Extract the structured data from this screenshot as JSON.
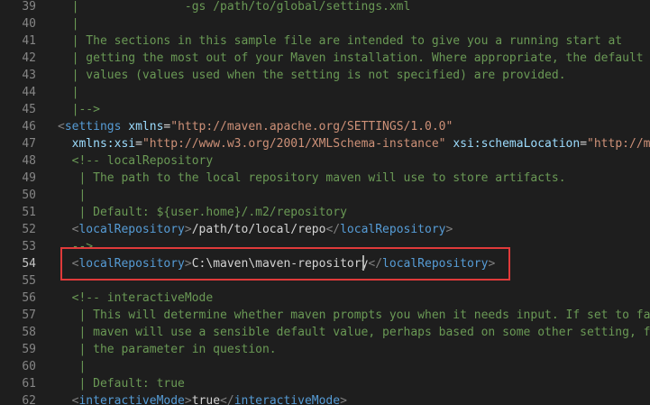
{
  "editor": {
    "colors": {
      "background": "#1e1e1e",
      "comment": "#6a9955",
      "tag": "#569cd6",
      "attribute": "#9cdcfe",
      "string": "#ce9178",
      "text": "#d4d4d4",
      "highlight_box": "#e03a3a"
    },
    "active_line": "54",
    "lines": [
      {
        "num": "39",
        "tokens": [
          {
            "t": "  | ",
            "c": "comment"
          },
          {
            "t": "              -gs /path/to/global/settings.xml",
            "c": "comment"
          }
        ]
      },
      {
        "num": "40",
        "tokens": [
          {
            "t": "  |",
            "c": "comment"
          }
        ]
      },
      {
        "num": "41",
        "tokens": [
          {
            "t": "  | The sections in this sample file are intended to give you a running start at",
            "c": "comment"
          }
        ]
      },
      {
        "num": "42",
        "tokens": [
          {
            "t": "  | getting the most out of your Maven installation. Where appropriate, the default",
            "c": "comment"
          }
        ]
      },
      {
        "num": "43",
        "tokens": [
          {
            "t": "  | values (values used when the setting is not specified) are provided.",
            "c": "comment"
          }
        ]
      },
      {
        "num": "44",
        "tokens": [
          {
            "t": "  |",
            "c": "comment"
          }
        ]
      },
      {
        "num": "45",
        "tokens": [
          {
            "t": "  |-->",
            "c": "comment"
          }
        ]
      },
      {
        "num": "46",
        "tokens": [
          {
            "t": "<",
            "c": "bracket"
          },
          {
            "t": "settings",
            "c": "tag"
          },
          {
            "t": " ",
            "c": "text"
          },
          {
            "t": "xmlns",
            "c": "attr"
          },
          {
            "t": "=",
            "c": "eq"
          },
          {
            "t": "\"http://maven.apache.org/SETTINGS/1.0.0\"",
            "c": "str"
          }
        ]
      },
      {
        "num": "47",
        "tokens": [
          {
            "t": "  ",
            "c": "text"
          },
          {
            "t": "xmlns:xsi",
            "c": "attr"
          },
          {
            "t": "=",
            "c": "eq"
          },
          {
            "t": "\"http://www.w3.org/2001/XMLSchema-instance\"",
            "c": "str"
          },
          {
            "t": " ",
            "c": "text"
          },
          {
            "t": "xsi:schemaLocation",
            "c": "attr"
          },
          {
            "t": "=",
            "c": "eq"
          },
          {
            "t": "\"http://mav",
            "c": "str"
          }
        ]
      },
      {
        "num": "48",
        "tokens": [
          {
            "t": "  <!-- localRepository",
            "c": "comment"
          }
        ]
      },
      {
        "num": "49",
        "tokens": [
          {
            "t": "   | The path to the local repository maven will use to store artifacts.",
            "c": "comment"
          }
        ]
      },
      {
        "num": "50",
        "tokens": [
          {
            "t": "   |",
            "c": "comment"
          }
        ]
      },
      {
        "num": "51",
        "tokens": [
          {
            "t": "   | Default: ${user.home}/.m2/repository",
            "c": "comment"
          }
        ]
      },
      {
        "num": "52",
        "tokens": [
          {
            "t": "  ",
            "c": "text"
          },
          {
            "t": "<",
            "c": "bracket"
          },
          {
            "t": "localRepository",
            "c": "tag"
          },
          {
            "t": ">",
            "c": "bracket"
          },
          {
            "t": "/path/to/local/repo",
            "c": "text"
          },
          {
            "t": "</",
            "c": "bracket"
          },
          {
            "t": "localRepository",
            "c": "tag"
          },
          {
            "t": ">",
            "c": "bracket"
          }
        ]
      },
      {
        "num": "53",
        "tokens": [
          {
            "t": "  -->",
            "c": "comment"
          }
        ]
      },
      {
        "num": "54",
        "tokens": [
          {
            "t": "  ",
            "c": "text"
          },
          {
            "t": "<",
            "c": "bracket"
          },
          {
            "t": "localRepository",
            "c": "tag"
          },
          {
            "t": ">",
            "c": "bracket"
          },
          {
            "t": "C:\\maven\\maven-repository",
            "c": "text"
          },
          {
            "t": "</",
            "c": "bracket"
          },
          {
            "t": "localRepository",
            "c": "tag"
          },
          {
            "t": ">",
            "c": "bracket"
          }
        ]
      },
      {
        "num": "55",
        "tokens": []
      },
      {
        "num": "56",
        "tokens": [
          {
            "t": "  <!-- interactiveMode",
            "c": "comment"
          }
        ]
      },
      {
        "num": "57",
        "tokens": [
          {
            "t": "   | This will determine whether maven prompts you when it needs input. If set to fals",
            "c": "comment"
          }
        ]
      },
      {
        "num": "58",
        "tokens": [
          {
            "t": "   | maven will use a sensible default value, perhaps based on some other setting, fo",
            "c": "comment"
          }
        ]
      },
      {
        "num": "59",
        "tokens": [
          {
            "t": "   | the parameter in question.",
            "c": "comment"
          }
        ]
      },
      {
        "num": "60",
        "tokens": [
          {
            "t": "   |",
            "c": "comment"
          }
        ]
      },
      {
        "num": "61",
        "tokens": [
          {
            "t": "   | Default: true",
            "c": "comment"
          }
        ]
      },
      {
        "num": "62",
        "tokens": [
          {
            "t": "  ",
            "c": "text"
          },
          {
            "t": "<",
            "c": "bracket"
          },
          {
            "t": "interactiveMode",
            "c": "tag"
          },
          {
            "t": ">",
            "c": "bracket"
          },
          {
            "t": "true",
            "c": "text"
          },
          {
            "t": "</",
            "c": "bracket"
          },
          {
            "t": "interactiveMode",
            "c": "tag"
          },
          {
            "t": ">",
            "c": "bracket"
          }
        ]
      }
    ]
  }
}
